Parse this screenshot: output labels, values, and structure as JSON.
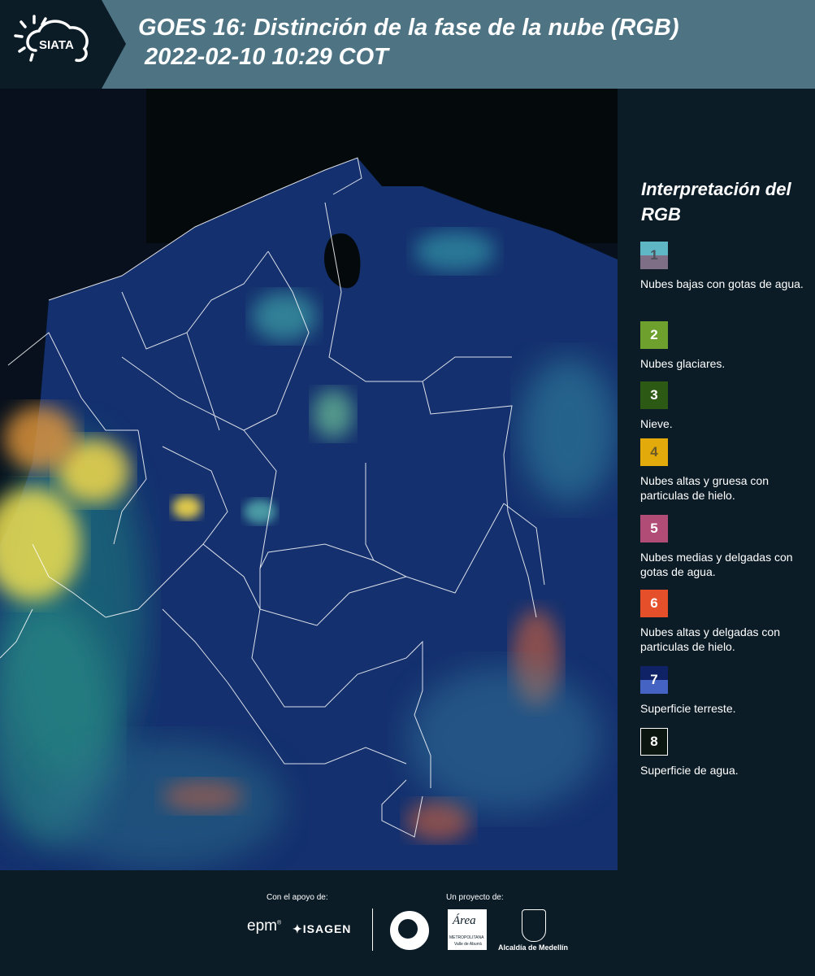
{
  "header": {
    "logo_text": "SIATA",
    "title_line1": "GOES 16: Distinción de la fase de la nube (RGB)",
    "title_line2": " 2022-02-10 10:29 COT"
  },
  "legend": {
    "title": "Interpretación del RGB",
    "items": [
      {
        "number": "1",
        "label": "Nubes bajas con gotas de agua.",
        "color_top": "#5fb6c4",
        "color_bottom": "#7f6f86",
        "number_color": "#4a4f5a"
      },
      {
        "number": "2",
        "label": "Nubes glaciares.",
        "color_top": "#6ea02e",
        "color_bottom": "#6ea02e",
        "number_color": "#ffffff"
      },
      {
        "number": "3",
        "label": "Nieve.",
        "color_top": "#2c5a14",
        "color_bottom": "#2c5a14",
        "number_color": "#ffffff"
      },
      {
        "number": "4",
        "label": "Nubes altas y gruesa con particulas de hielo.",
        "color_top": "#e2aa0a",
        "color_bottom": "#e2aa0a",
        "number_color": "#6a5a2a"
      },
      {
        "number": "5",
        "label": "Nubes medias y delgadas con gotas de agua.",
        "color_top": "#b14c77",
        "color_bottom": "#b14c77",
        "number_color": "#ffffff"
      },
      {
        "number": "6",
        "label": "Nubes altas y delgadas con particulas de hielo.",
        "color_top": "#e5502a",
        "color_bottom": "#e5502a",
        "number_color": "#ffffff"
      },
      {
        "number": "7",
        "label": "Superficie terreste.",
        "color_top": "#102266",
        "color_bottom": "#4463c2",
        "number_color": "#ffffff"
      },
      {
        "number": "8",
        "label": "Superficie de agua.",
        "color_top": "#0c1611",
        "color_bottom": "#0c1611",
        "number_color": "#ffffff"
      }
    ]
  },
  "footer": {
    "support_label": "Con el apoyo de:",
    "project_label": "Un proyecto de:",
    "sponsor1": "epm",
    "sponsor2": "ISAGEN",
    "partner2_name": "Área",
    "partner2_sub1": "METROPOLITANA",
    "partner2_sub2": "Valle de Aburrá",
    "partner3": "Alcaldía de Medellín"
  },
  "colors": {
    "header_bg": "#4e7484",
    "panel_bg": "#0c1c27",
    "map_land": "#14306e",
    "map_water": "#07101c"
  }
}
